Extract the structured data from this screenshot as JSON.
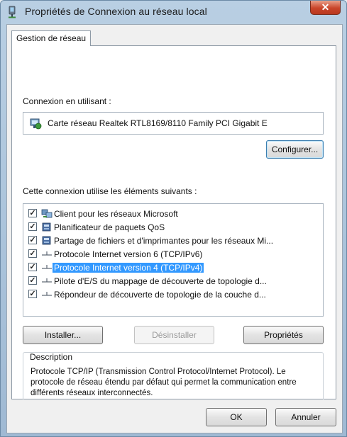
{
  "window": {
    "title": "Propriétés de Connexion au réseau local",
    "close_glyph": "✕"
  },
  "tabs": [
    {
      "label": "Gestion de réseau"
    }
  ],
  "connect_using": {
    "label": "Connexion en utilisant :",
    "adapter": "Carte réseau Realtek RTL8169/8110 Family PCI Gigabit E",
    "adapter_icon": "network-adapter-icon"
  },
  "configure_button": "Configurer...",
  "items_label": "Cette connexion utilise les éléments suivants :",
  "items": [
    {
      "label": "Client pour les réseaux Microsoft",
      "checked": true,
      "icon": "network-client-icon",
      "check": "✓"
    },
    {
      "label": "Planificateur de paquets QoS",
      "checked": true,
      "icon": "service-icon",
      "check": "✓"
    },
    {
      "label": "Partage de fichiers et d'imprimantes pour les réseaux Mi...",
      "checked": true,
      "icon": "service-icon",
      "check": "✓"
    },
    {
      "label": "Protocole Internet version 6 (TCP/IPv6)",
      "checked": true,
      "icon": "protocol-icon",
      "check": "✓"
    },
    {
      "label": "Protocole Internet version 4 (TCP/IPv4)",
      "checked": true,
      "icon": "protocol-icon",
      "check": "✓",
      "selected": true
    },
    {
      "label": "Pilote d'E/S du mappage de découverte de topologie d...",
      "checked": true,
      "icon": "protocol-icon",
      "check": "✓"
    },
    {
      "label": "Répondeur de découverte de topologie de la couche d...",
      "checked": true,
      "icon": "protocol-icon",
      "check": "✓"
    }
  ],
  "buttons": {
    "install": "Installer...",
    "uninstall": "Désinstaller",
    "properties": "Propriétés",
    "ok": "OK",
    "cancel": "Annuler"
  },
  "description": {
    "legend": "Description",
    "text": "Protocole TCP/IP (Transmission Control Protocol/Internet Protocol). Le protocole de réseau étendu par défaut qui permet la communication entre différents réseaux interconnectés."
  },
  "colors": {
    "selection": "#3399ff",
    "close_button": "#c9452a"
  }
}
